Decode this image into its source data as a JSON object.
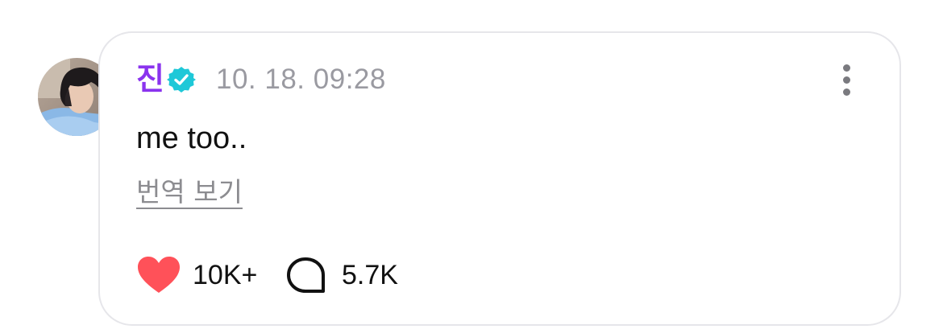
{
  "post": {
    "author": "진",
    "verified": true,
    "timestamp": "10. 18. 09:28",
    "text": "me too..",
    "translate_label": "번역 보기"
  },
  "actions": {
    "like_count": "10K+",
    "comment_count": "5.7K"
  },
  "icons": {
    "verified": "verified-badge-icon",
    "more": "more-vertical-icon",
    "like": "heart-icon",
    "comment": "comment-bubble-icon"
  },
  "colors": {
    "author": "#8a33ee",
    "verified_badge": "#1ec8d8",
    "heart": "#ff5159",
    "muted_text": "#9a9aa1",
    "card_border": "#e6e6ea"
  }
}
